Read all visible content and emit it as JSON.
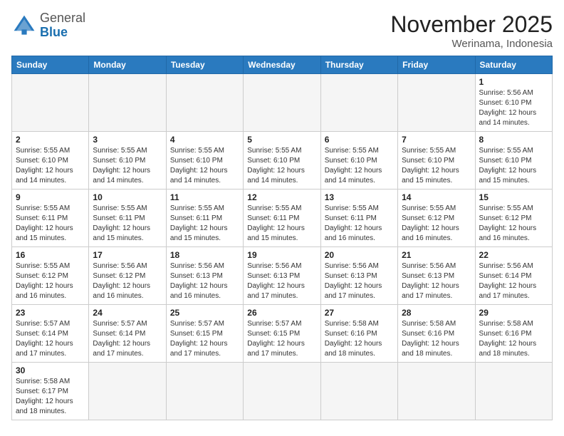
{
  "header": {
    "logo_general": "General",
    "logo_blue": "Blue",
    "month_title": "November 2025",
    "location": "Werinama, Indonesia"
  },
  "weekdays": [
    "Sunday",
    "Monday",
    "Tuesday",
    "Wednesday",
    "Thursday",
    "Friday",
    "Saturday"
  ],
  "days": {
    "1": {
      "sunrise": "5:56 AM",
      "sunset": "6:10 PM",
      "daylight": "12 hours and 14 minutes."
    },
    "2": {
      "sunrise": "5:55 AM",
      "sunset": "6:10 PM",
      "daylight": "12 hours and 14 minutes."
    },
    "3": {
      "sunrise": "5:55 AM",
      "sunset": "6:10 PM",
      "daylight": "12 hours and 14 minutes."
    },
    "4": {
      "sunrise": "5:55 AM",
      "sunset": "6:10 PM",
      "daylight": "12 hours and 14 minutes."
    },
    "5": {
      "sunrise": "5:55 AM",
      "sunset": "6:10 PM",
      "daylight": "12 hours and 14 minutes."
    },
    "6": {
      "sunrise": "5:55 AM",
      "sunset": "6:10 PM",
      "daylight": "12 hours and 14 minutes."
    },
    "7": {
      "sunrise": "5:55 AM",
      "sunset": "6:10 PM",
      "daylight": "12 hours and 15 minutes."
    },
    "8": {
      "sunrise": "5:55 AM",
      "sunset": "6:10 PM",
      "daylight": "12 hours and 15 minutes."
    },
    "9": {
      "sunrise": "5:55 AM",
      "sunset": "6:11 PM",
      "daylight": "12 hours and 15 minutes."
    },
    "10": {
      "sunrise": "5:55 AM",
      "sunset": "6:11 PM",
      "daylight": "12 hours and 15 minutes."
    },
    "11": {
      "sunrise": "5:55 AM",
      "sunset": "6:11 PM",
      "daylight": "12 hours and 15 minutes."
    },
    "12": {
      "sunrise": "5:55 AM",
      "sunset": "6:11 PM",
      "daylight": "12 hours and 15 minutes."
    },
    "13": {
      "sunrise": "5:55 AM",
      "sunset": "6:11 PM",
      "daylight": "12 hours and 16 minutes."
    },
    "14": {
      "sunrise": "5:55 AM",
      "sunset": "6:12 PM",
      "daylight": "12 hours and 16 minutes."
    },
    "15": {
      "sunrise": "5:55 AM",
      "sunset": "6:12 PM",
      "daylight": "12 hours and 16 minutes."
    },
    "16": {
      "sunrise": "5:55 AM",
      "sunset": "6:12 PM",
      "daylight": "12 hours and 16 minutes."
    },
    "17": {
      "sunrise": "5:56 AM",
      "sunset": "6:12 PM",
      "daylight": "12 hours and 16 minutes."
    },
    "18": {
      "sunrise": "5:56 AM",
      "sunset": "6:13 PM",
      "daylight": "12 hours and 16 minutes."
    },
    "19": {
      "sunrise": "5:56 AM",
      "sunset": "6:13 PM",
      "daylight": "12 hours and 17 minutes."
    },
    "20": {
      "sunrise": "5:56 AM",
      "sunset": "6:13 PM",
      "daylight": "12 hours and 17 minutes."
    },
    "21": {
      "sunrise": "5:56 AM",
      "sunset": "6:13 PM",
      "daylight": "12 hours and 17 minutes."
    },
    "22": {
      "sunrise": "5:56 AM",
      "sunset": "6:14 PM",
      "daylight": "12 hours and 17 minutes."
    },
    "23": {
      "sunrise": "5:57 AM",
      "sunset": "6:14 PM",
      "daylight": "12 hours and 17 minutes."
    },
    "24": {
      "sunrise": "5:57 AM",
      "sunset": "6:14 PM",
      "daylight": "12 hours and 17 minutes."
    },
    "25": {
      "sunrise": "5:57 AM",
      "sunset": "6:15 PM",
      "daylight": "12 hours and 17 minutes."
    },
    "26": {
      "sunrise": "5:57 AM",
      "sunset": "6:15 PM",
      "daylight": "12 hours and 17 minutes."
    },
    "27": {
      "sunrise": "5:58 AM",
      "sunset": "6:16 PM",
      "daylight": "12 hours and 18 minutes."
    },
    "28": {
      "sunrise": "5:58 AM",
      "sunset": "6:16 PM",
      "daylight": "12 hours and 18 minutes."
    },
    "29": {
      "sunrise": "5:58 AM",
      "sunset": "6:16 PM",
      "daylight": "12 hours and 18 minutes."
    },
    "30": {
      "sunrise": "5:58 AM",
      "sunset": "6:17 PM",
      "daylight": "12 hours and 18 minutes."
    }
  }
}
